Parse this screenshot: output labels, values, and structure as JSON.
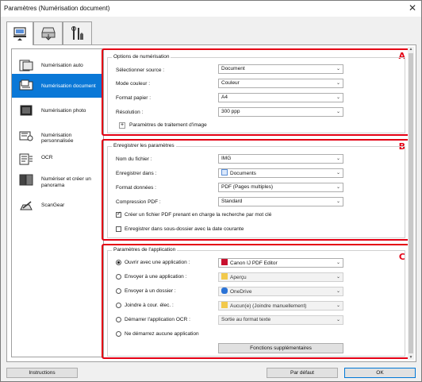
{
  "window": {
    "title": "Paramètres (Numérisation document)",
    "close_glyph": "✕"
  },
  "top_tabs": [
    {
      "name": "scan-from-computer",
      "icon": "computer-scan-icon"
    },
    {
      "name": "scan-from-operation-panel",
      "icon": "operation-panel-icon"
    },
    {
      "name": "general-settings",
      "icon": "tools-icon"
    }
  ],
  "sidebar": {
    "items": [
      {
        "label": "Numérisation auto",
        "icon": "auto-scan-icon"
      },
      {
        "label": "Numérisation document",
        "icon": "document-scan-icon",
        "selected": true
      },
      {
        "label": "Numérisation photo",
        "icon": "photo-scan-icon"
      },
      {
        "label": "Numérisation personnalisée",
        "icon": "custom-scan-icon"
      },
      {
        "label": "OCR",
        "icon": "ocr-icon"
      },
      {
        "label_line1": "Numériser et créer un",
        "label_line2": "panorama",
        "icon": "panorama-icon"
      },
      {
        "label": "ScanGear",
        "icon": "scangear-icon"
      }
    ]
  },
  "scan_options": {
    "title": "Options de numérisation",
    "marker": "A",
    "source_label": "Sélectionner source :",
    "source_value": "Document",
    "color_label": "Mode couleur :",
    "color_value": "Couleur",
    "paper_label": "Format papier :",
    "paper_value": "A4",
    "resolution_label": "Résolution :",
    "resolution_value": "300 ppp",
    "image_processing_label": "Paramètres de traitement d'image",
    "plus_glyph": "+"
  },
  "save_settings": {
    "title": "Enregistrer les paramètres",
    "marker": "B",
    "filename_label": "Nom du fichier :",
    "filename_value": "IMG",
    "save_in_label": "Enregistrer dans :",
    "save_in_value": "Documents",
    "format_label": "Format données :",
    "format_value": "PDF (Pages multiples)",
    "compression_label": "Compression PDF :",
    "compression_value": "Standard",
    "searchable_pdf_label": "Créer un fichier PDF prenant en charge la recherche par mot clé",
    "searchable_pdf_checked": true,
    "subfolder_label": "Enregistrer dans sous-dossier avec la date courante",
    "subfolder_checked": false
  },
  "app_settings": {
    "title": "Paramètres de l'application",
    "marker": "C",
    "open_app_label": "Ouvrir avec une application :",
    "open_app_value": "Canon IJ PDF Editor",
    "send_app_label": "Envoyer à une application :",
    "send_app_value": "Aperçu",
    "send_folder_label": "Envoyer à un dossier :",
    "send_folder_value": "OneDrive",
    "email_label": "Joindre à cour. élec. :",
    "email_value": "Aucun(e) (Joindre manuellement)",
    "ocr_label": "Démarrer l'application OCR :",
    "ocr_value": "Sortie au format texte",
    "no_app_label": "Ne démarrez aucune application",
    "more_functions_label": "Fonctions supplémentaires",
    "selected_option": "open_app"
  },
  "footer": {
    "instructions_label": "Instructions",
    "default_label": "Par défaut",
    "ok_label": "OK"
  },
  "colors": {
    "accent": "#0a78d7",
    "highlight_border": "#e40014",
    "pdf_red": "#c8102e",
    "folder_yellow": "#f2c94c"
  }
}
